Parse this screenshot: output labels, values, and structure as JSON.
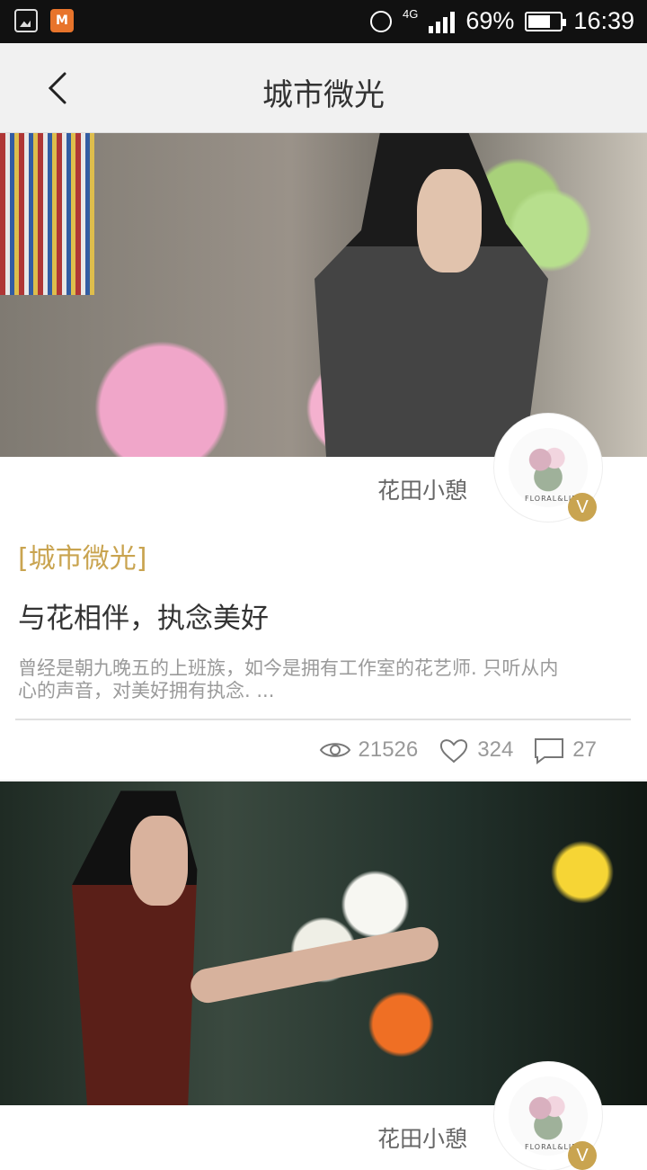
{
  "status_bar": {
    "network": "4G",
    "battery_percent": "69%",
    "battery_level": 0.69,
    "time": "16:39",
    "app_badge": "M"
  },
  "header": {
    "back_icon": "chevron-left-icon",
    "title": "城市微光"
  },
  "posts": [
    {
      "author": "花田小憩",
      "avatar_caption": "FLORAL&LIFE",
      "verified_badge": "V",
      "tag": "[城市微光]",
      "title": "与花相伴，执念美好",
      "summary": "曾经是朝九晚五的上班族，如今是拥有工作室的花艺师. 只听从内心的声音，对美好拥有执念. ...",
      "views": "21526",
      "likes": "324",
      "comments": "27"
    },
    {
      "author": "花田小憩",
      "avatar_caption": "FLORAL&LIFE",
      "verified_badge": "V"
    }
  ]
}
